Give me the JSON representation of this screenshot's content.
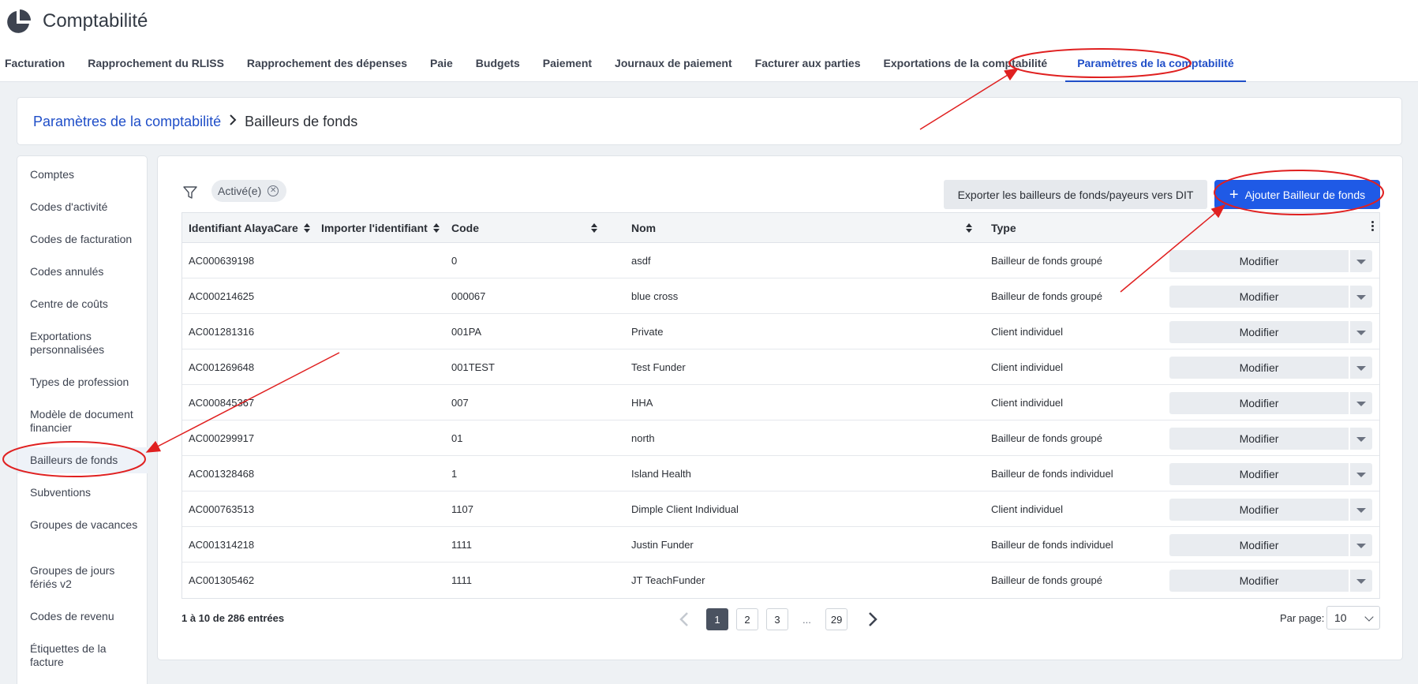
{
  "app": {
    "title": "Comptabilité",
    "logo_icon": "pie-chart-icon"
  },
  "nav": {
    "tabs": [
      {
        "label": "Facturation"
      },
      {
        "label": "Rapprochement du RLISS"
      },
      {
        "label": "Rapprochement des dépenses"
      },
      {
        "label": "Paie"
      },
      {
        "label": "Budgets"
      },
      {
        "label": "Paiement"
      },
      {
        "label": "Journaux de paiement"
      },
      {
        "label": "Facturer aux parties"
      },
      {
        "label": "Exportations de la comptabilité"
      },
      {
        "label": "Paramètres de la comptabilité",
        "active": true
      }
    ]
  },
  "breadcrumb": {
    "parent": "Paramètres de la comptabilité",
    "current": "Bailleurs de fonds"
  },
  "sidebar": {
    "items": [
      {
        "label": "Comptes"
      },
      {
        "label": "Codes d'activité"
      },
      {
        "label": "Codes de facturation"
      },
      {
        "label": "Codes annulés"
      },
      {
        "label": "Centre de coûts"
      },
      {
        "label": "Exportations personnalisées"
      },
      {
        "label": "Types de profession"
      },
      {
        "label": "Modèle de document financier"
      },
      {
        "label": "Bailleurs de fonds",
        "active": true
      },
      {
        "label": "Subventions"
      },
      {
        "label": "Groupes de vacances"
      },
      {
        "label": "Groupes de jours fériés v2"
      },
      {
        "label": "Codes de revenu"
      },
      {
        "label": "Étiquettes de la facture"
      }
    ]
  },
  "toolbar": {
    "filter_chip": "Activé(e)",
    "export_label": "Exporter les bailleurs de fonds/payeurs vers DIT",
    "add_label": "Ajouter Bailleur de fonds"
  },
  "table": {
    "headers": [
      "Identifiant AlayaCare",
      "Importer l'identifiant",
      "Code",
      "Nom",
      "Type"
    ],
    "action_label": "Modifier",
    "rows": [
      {
        "id": "AC000639198",
        "import_id": "",
        "code": "0",
        "name": "asdf",
        "type": "Bailleur de fonds groupé"
      },
      {
        "id": "AC000214625",
        "import_id": "",
        "code": "000067",
        "name": "blue cross",
        "type": "Bailleur de fonds groupé"
      },
      {
        "id": "AC001281316",
        "import_id": "",
        "code": "001PA",
        "name": "Private",
        "type": "Client individuel"
      },
      {
        "id": "AC001269648",
        "import_id": "",
        "code": "001TEST",
        "name": "Test Funder",
        "type": "Client individuel"
      },
      {
        "id": "AC000845367",
        "import_id": "",
        "code": "007",
        "name": "HHA",
        "type": "Client individuel"
      },
      {
        "id": "AC000299917",
        "import_id": "",
        "code": "01",
        "name": "north",
        "type": "Bailleur de fonds groupé"
      },
      {
        "id": "AC001328468",
        "import_id": "",
        "code": "1",
        "name": "Island Health",
        "type": "Bailleur de fonds individuel"
      },
      {
        "id": "AC000763513",
        "import_id": "",
        "code": "1107",
        "name": "Dimple Client Individual",
        "type": "Client individuel"
      },
      {
        "id": "AC001314218",
        "import_id": "",
        "code": "1111",
        "name": "Justin Funder",
        "type": "Bailleur de fonds individuel"
      },
      {
        "id": "AC001305462",
        "import_id": "",
        "code": "1111",
        "name": "JT TeachFunder",
        "type": "Bailleur de fonds groupé"
      }
    ]
  },
  "footer": {
    "entries": "1 à 10 de 286 entrées",
    "pages": [
      "1",
      "2",
      "3",
      "29"
    ],
    "ellipsis": "...",
    "current_page": "1",
    "per_page_label": "Par page:",
    "per_page_value": "10"
  },
  "colors": {
    "accent": "#1f4ec8",
    "primary_button": "#1f5ae6",
    "annotation": "#e02020"
  }
}
